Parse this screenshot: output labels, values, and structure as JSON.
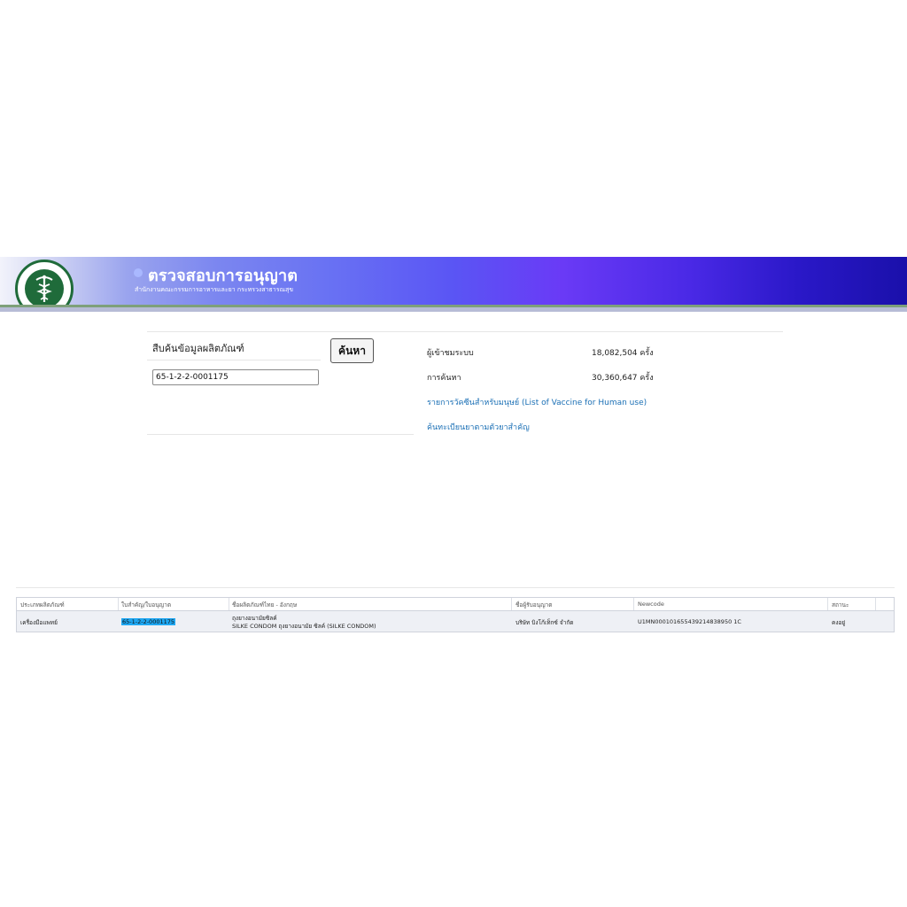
{
  "banner": {
    "title": "ตรวจสอบการอนุญาต",
    "subtitle": "สำนักงานคณะกรรมการอาหารและยา กระทรวงสาธารณสุข",
    "logo_text": "MINISTRY OF PUBLIC HEALTH",
    "gradient_start": "#f2f3fb",
    "gradient_end": "#1a10aa"
  },
  "search": {
    "title": "สืบค้นข้อมูลผลิตภัณฑ์",
    "button_label": "ค้นหา",
    "input_value": "65-1-2-2-0001175"
  },
  "stats": {
    "visitors_label": "ผู้เข้าชมระบบ",
    "visitors_value": "18,082,504 ครั้ง",
    "searches_label": "การค้นหา",
    "searches_value": "30,360,647 ครั้ง"
  },
  "links": {
    "vaccine_list": "รายการวัคซีนสำหรับมนุษย์ (List of Vaccine for Human use)",
    "drug_search": "ค้นทะเบียนยาตามตัวยาสำคัญ"
  },
  "table": {
    "headers": {
      "product_type": "ประเภทผลิตภัณฑ์",
      "registration_no": "ใบสำคัญ/ใบอนุญาต",
      "product_name": "ชื่อผลิตภัณฑ์ไทย - อังกฤษ",
      "licensee": "ชื่อผู้รับอนุญาต",
      "newcode": "Newcode",
      "status": "สถานะ"
    },
    "rows": [
      {
        "product_type": "เครื่องมือแพทย์",
        "registration_no": "65-1-2-2-0001175",
        "product_name_th": "ถุงยางอนามัยซิลค์",
        "product_name_en": "SILKE CONDOM ถุงยางอนามัย ซิลค์ (SILKE CONDOM)",
        "licensee": "บริษัท บิงโก้เท็กซ์ จำกัด",
        "newcode": "U1MN000101655439214838950 1C",
        "status": "คงอยู่"
      }
    ]
  },
  "colors": {
    "link": "#1a6fb5",
    "highlight": "#1ea7f2",
    "row_background": "#eef0f5"
  }
}
